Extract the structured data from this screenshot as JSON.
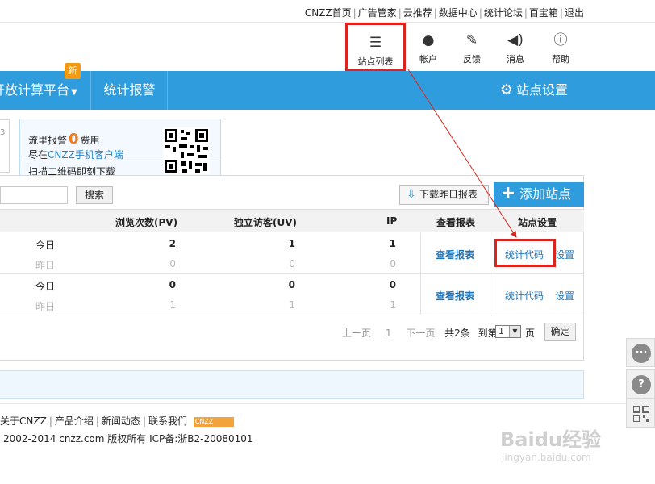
{
  "topbar": {
    "links": [
      "CNZZ首页",
      "广告管家",
      "云推荐",
      "数据中心",
      "统计论坛",
      "百宝箱",
      "退出"
    ]
  },
  "header": {
    "icons": [
      {
        "label": "站点列表",
        "icon": "list-icon"
      },
      {
        "label": "帐户",
        "icon": "user-icon"
      },
      {
        "label": "反馈",
        "icon": "edit-icon"
      },
      {
        "label": "消息",
        "icon": "speaker-icon"
      },
      {
        "label": "帮助",
        "icon": "help-icon"
      }
    ]
  },
  "nav": {
    "platform_label": "开放计算平台",
    "new_badge": "新",
    "alert_label": "统计报警",
    "settings_label": "站点设置"
  },
  "promo": {
    "line1_prefix": "流里报警",
    "line1_count": "0",
    "line1_suffix": "费用",
    "line2_prefix": "尽在",
    "line2_link": "CNZZ手机客户端",
    "line3": "扫描二维码即刻下载"
  },
  "left_stub": "3",
  "toolbar": {
    "search_label": "搜索",
    "download_label": "下载昨日报表",
    "add_label": "添加站点"
  },
  "table": {
    "headers": {
      "pv": "浏览次数(PV)",
      "uv": "独立访客(UV)",
      "ip": "IP",
      "report": "查看报表",
      "settings": "站点设置"
    },
    "rows": [
      {
        "today_label": "今日",
        "today_pv": "2",
        "today_uv": "1",
        "today_ip": "1",
        "yest_label": "昨日",
        "yest_pv": "0",
        "yest_uv": "0",
        "yest_ip": "0",
        "report": "查看报表",
        "code": "统计代码",
        "setting": "设置"
      },
      {
        "today_label": "今日",
        "today_pv": "0",
        "today_uv": "0",
        "today_ip": "0",
        "yest_label": "昨日",
        "yest_pv": "1",
        "yest_uv": "1",
        "yest_ip": "1",
        "report": "查看报表",
        "code": "统计代码",
        "setting": "设置"
      }
    ]
  },
  "pager": {
    "prev": "上一页",
    "page": "1",
    "next": "下一页",
    "total": "共2条",
    "goto": "到第",
    "select_value": "1",
    "page_unit": "页",
    "confirm": "确定"
  },
  "footer": {
    "links": [
      "关于CNZZ",
      "产品介绍",
      "新闻动态",
      "联系我们"
    ],
    "logo_text": "CNZZ",
    "copyright": "2002-2014 cnzz.com 版权所有 ICP备:浙B2-20080101"
  },
  "watermark": {
    "line1": "Baidu经验",
    "line2": "jingyan.baidu.com"
  },
  "colors": {
    "nav_blue": "#2f9ddd",
    "highlight_red": "#d9251d",
    "badge_orange": "#f39a14"
  }
}
